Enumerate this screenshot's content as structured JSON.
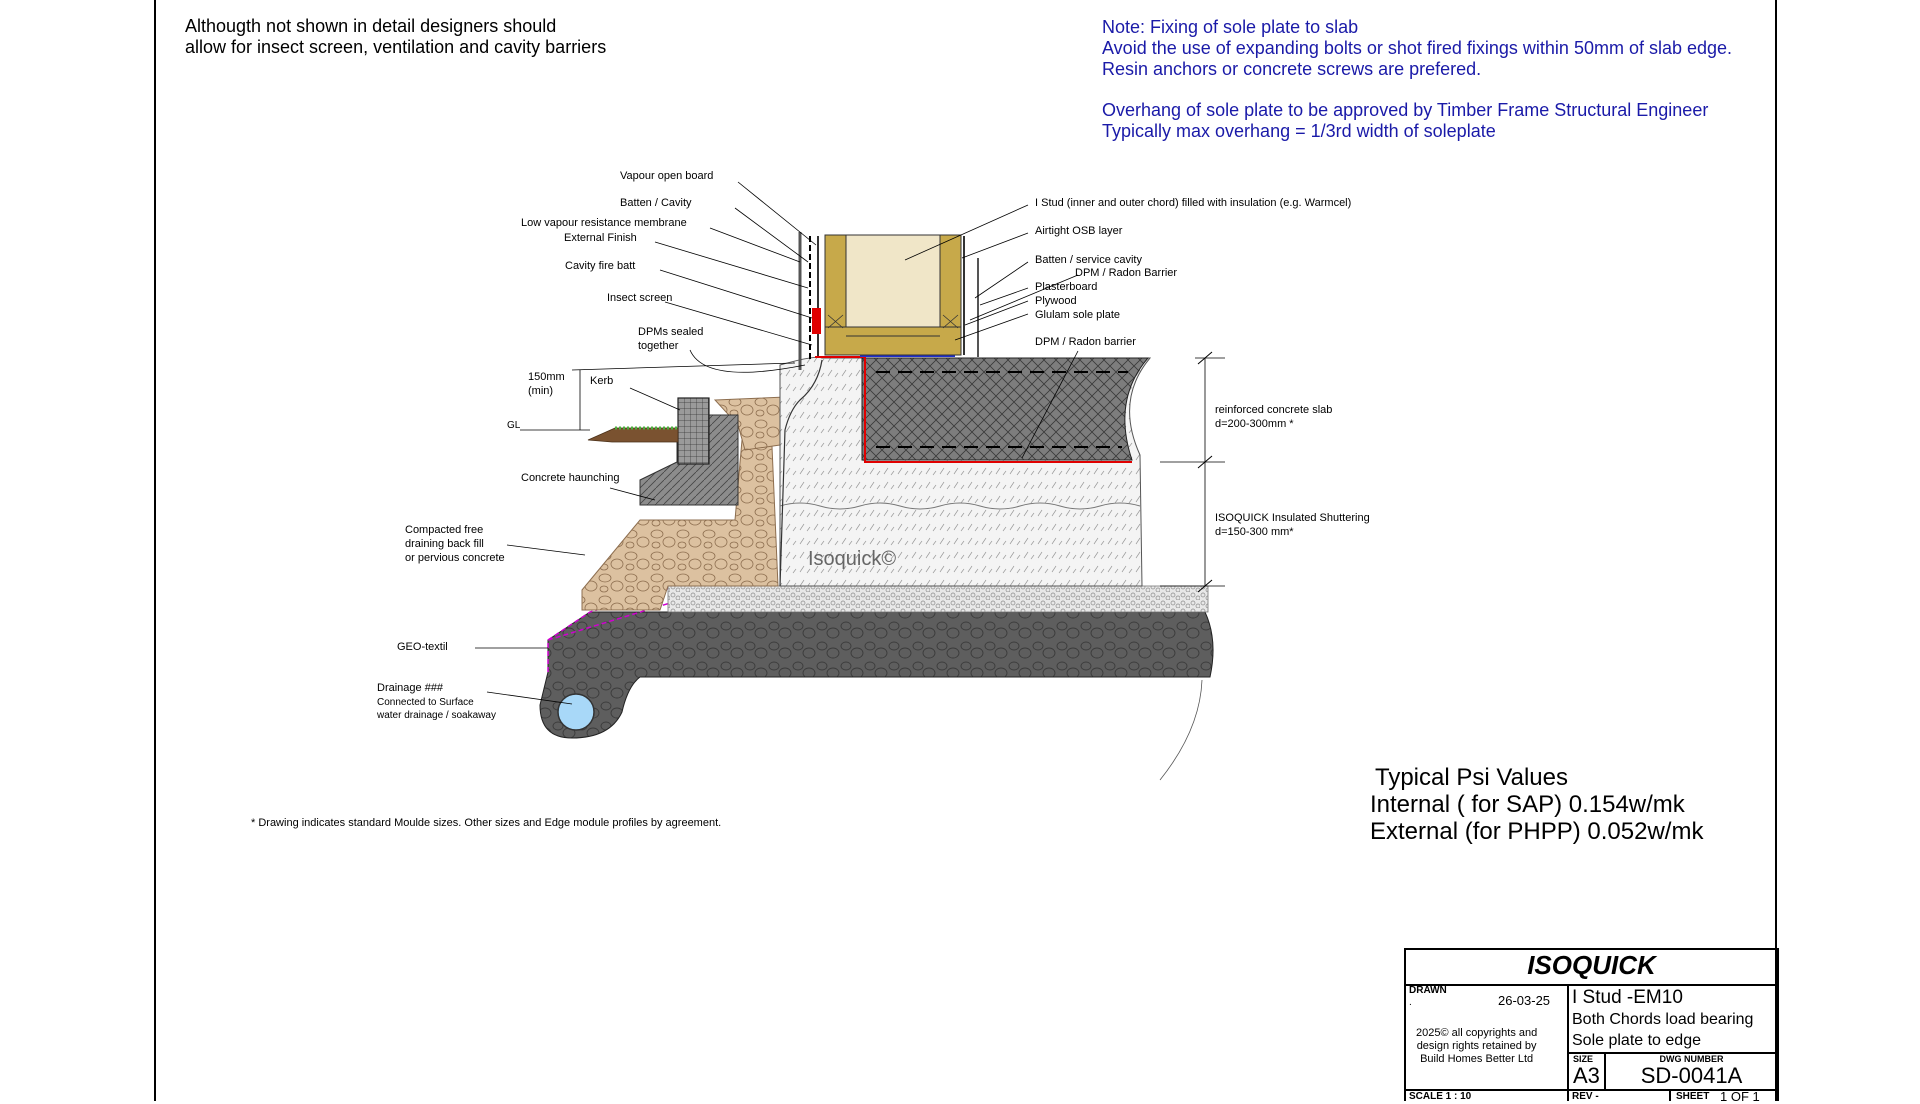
{
  "notes": {
    "general": [
      "Althougth not shown  in detail designers should",
      "allow for insect screen, ventilation and cavity barriers"
    ],
    "fixing": [
      "Note: Fixing of sole plate to slab",
      " Avoid the use of expanding bolts or shot fired fixings within 50mm of slab edge.",
      "Resin anchors or concrete screws are prefered.",
      "",
      "Overhang of sole plate to be approved by Timber Frame Structural Engineer",
      "Typically max overhang = 1/3rd width of soleplate"
    ]
  },
  "labels": {
    "vapour_open_board": "Vapour open board",
    "batten_cavity": "Batten / Cavity",
    "low_vapour_membrane": "Low vapour resistance membrane",
    "external_finish": "External Finish",
    "cavity_fire_batt": "Cavity fire batt",
    "insect_screen": "Insect screen",
    "dpms_sealed_1": "DPMs sealed",
    "dpms_sealed_2": "together",
    "dim_150": "150mm",
    "dim_min": "(min)",
    "kerb": "Kerb",
    "gl": "GL",
    "concrete_haunching": "Concrete haunching",
    "backfill_1": "Compacted free",
    "backfill_2": "draining back fill",
    "backfill_3": "or pervious concrete",
    "geotextil": "GEO-textil",
    "drainage_1": "Drainage ###",
    "drainage_2": "Connected to Surface",
    "drainage_3": "water drainage / soakaway",
    "i_stud": "I Stud (inner and outer chord) filled with insulation (e.g. Warmcel)",
    "airtight_osb": "Airtight OSB layer",
    "batten_service": "Batten / service cavity",
    "dpm_radon_1": "DPM / Radon Barrier",
    "plasterboard": "Plasterboard",
    "plywood": "Plywood",
    "glulam": "Glulam sole plate",
    "dpm_radon_2": "DPM / Radon barrier",
    "slab_1": "reinforced concrete slab",
    "slab_2": "d=200-300mm *",
    "shutter_1": "ISOQUICK Insulated Shuttering",
    "shutter_2": "d=150-300 mm*",
    "watermark": "Isoquick©"
  },
  "footnote": "* Drawing indicates standard Moulde sizes. Other sizes and Edge module profiles by agreement.",
  "psi": {
    "title": "Typical Psi Values",
    "internal": "Internal ( for SAP) 0.154w/mk",
    "external": "External (for PHPP) 0.052w/mk"
  },
  "title_block": {
    "company": "ISOQUICK",
    "drawn_label": "DRAWN",
    "drawn_by": ".",
    "date": "26-03-25",
    "title_1": "I Stud -EM10",
    "title_2": "Both Chords load bearing",
    "title_3": "Sole plate to edge",
    "copyright_1": "2025© all copyrights and",
    "copyright_2": "design rights retained by",
    "copyright_3": "Build Homes Better Ltd",
    "size_label": "SIZE",
    "size": "A3",
    "dwg_label": "DWG NUMBER",
    "dwg_number": "SD-0041A",
    "scale": "SCALE  1 : 10",
    "rev": "REV   -",
    "sheet_label": "SHEET",
    "sheet": "1 OF 1"
  },
  "colors": {
    "frame": "#000000",
    "note_blue": "#1a1aa8",
    "timber": "#c7a94a",
    "insulation_fill": "#f0e6c8",
    "concrete_dark": "#6e6e6e",
    "shuttering": "#f2f2f2",
    "gravel": "#d8b894",
    "dpm_red": "#e00000",
    "insect_screen_red": "#e00000",
    "geotextil_magenta": "#d000d0",
    "grass": "#4caf3c",
    "soil": "#7a5230",
    "drain_water": "#a8d8f8"
  }
}
